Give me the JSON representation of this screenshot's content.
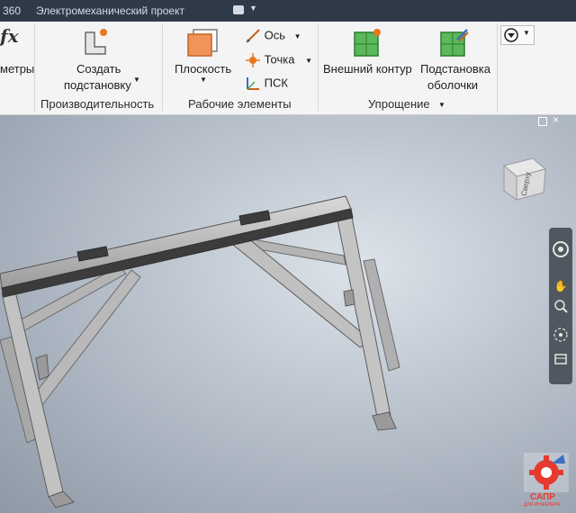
{
  "titlebar": {
    "app_fragment": "360",
    "project_title": "Электромеханический проект"
  },
  "ribbon": {
    "params_partial": "метры",
    "create_substitute_line1": "Создать",
    "create_substitute_line2": "подстановку",
    "productivity_label": "Производительность",
    "plane_label": "Плоскость",
    "axis_label": "Ось",
    "point_label": "Точка",
    "ucs_label": "ПСК",
    "work_features_label": "Рабочие элементы",
    "outer_contour_label": "Внешний контур",
    "shell_substitute_line1": "Подстановка",
    "shell_substitute_line2": "оболочки",
    "simplification_label": "Упрощение",
    "fx_glyph": "fx"
  },
  "viewcube": {
    "face_label": "Сверху"
  },
  "watermark": {
    "brand": "САПР",
    "tagline": "ДЛЯ ИНЖЕНЕРА"
  },
  "colors": {
    "tabbar_bg": "#2f3a49",
    "ribbon_bg": "#f4f4f4",
    "accent_orange": "#e8761c",
    "accent_green": "#4aa34a",
    "navbar_bg": "#50575f"
  }
}
